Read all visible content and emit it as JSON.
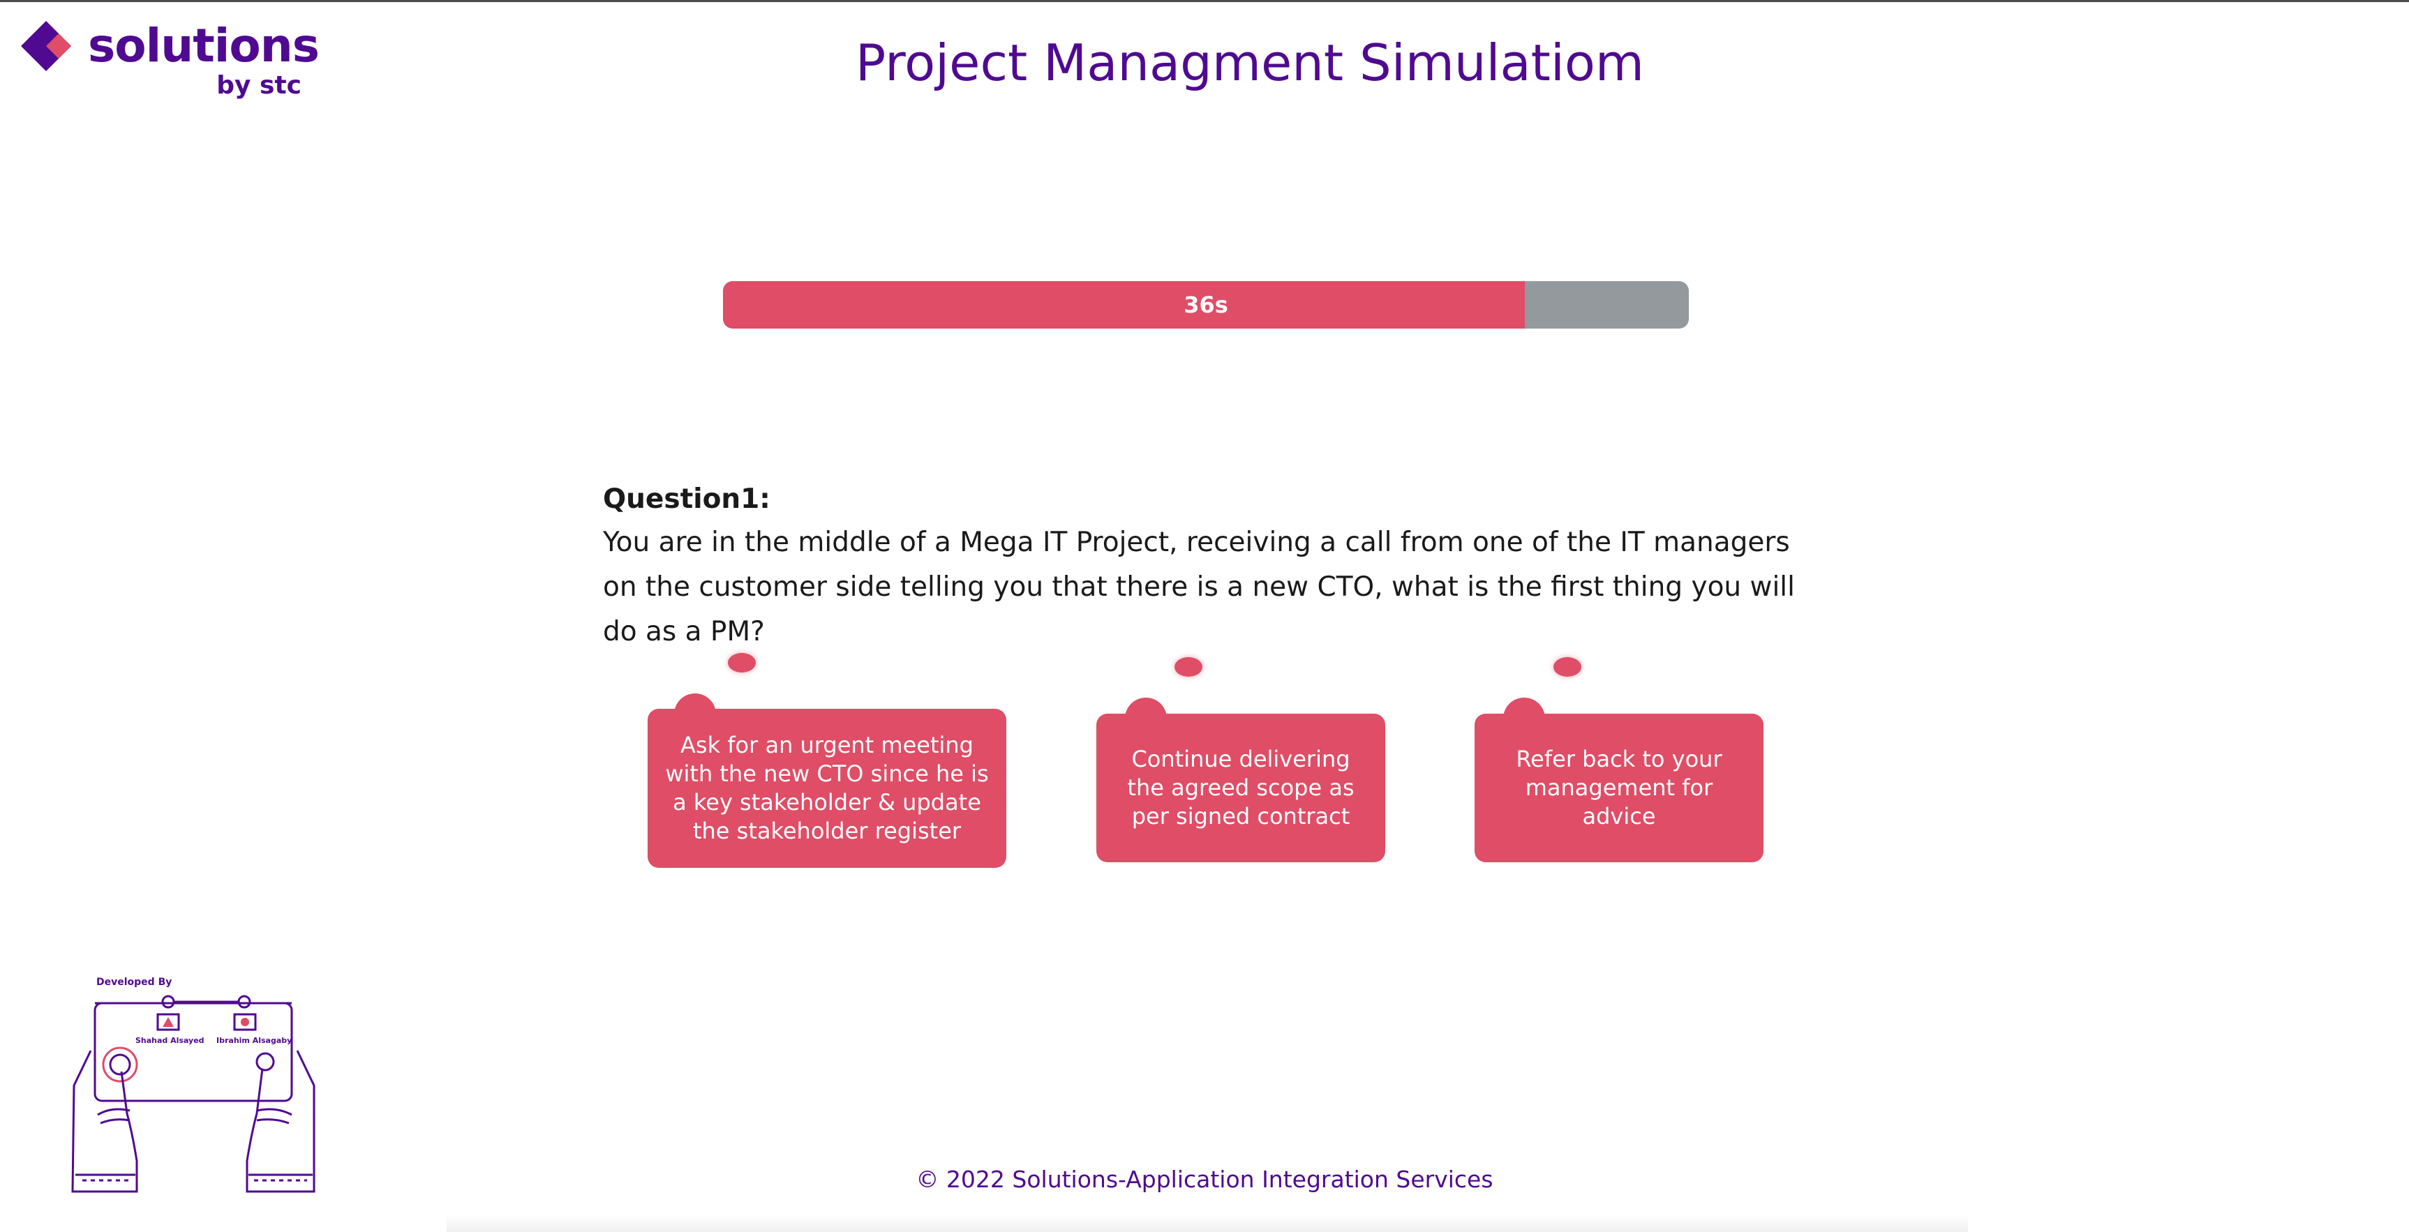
{
  "logo": {
    "word": "solutions",
    "by": "by stc"
  },
  "page": {
    "title": "Project Managment Simulatiom"
  },
  "timer": {
    "label": "36s",
    "remaining_fraction": 0.83
  },
  "question": {
    "heading": "Question1:",
    "text": "You are in the middle of a Mega IT Project, receiving a call from one of the IT managers on the customer side telling you that there is a new CTO, what is the first thing you will do as a PM?"
  },
  "answers": [
    {
      "label": "Ask for an urgent meeting with the new CTO since he is a key stakeholder & update the stakeholder register"
    },
    {
      "label": "Continue delivering the agreed scope as per signed contract"
    },
    {
      "label": "Refer back to your management for advice"
    }
  ],
  "developers": {
    "label": "Developed By",
    "names": [
      "Shahad Alsayed",
      "Ibrahim Alsagaby"
    ]
  },
  "footer": {
    "text": "© 2022 Solutions-Application Integration Services"
  },
  "colors": {
    "brand_purple": "#4f0a91",
    "accent_red": "#df4d66",
    "track_gray": "#94999e"
  }
}
